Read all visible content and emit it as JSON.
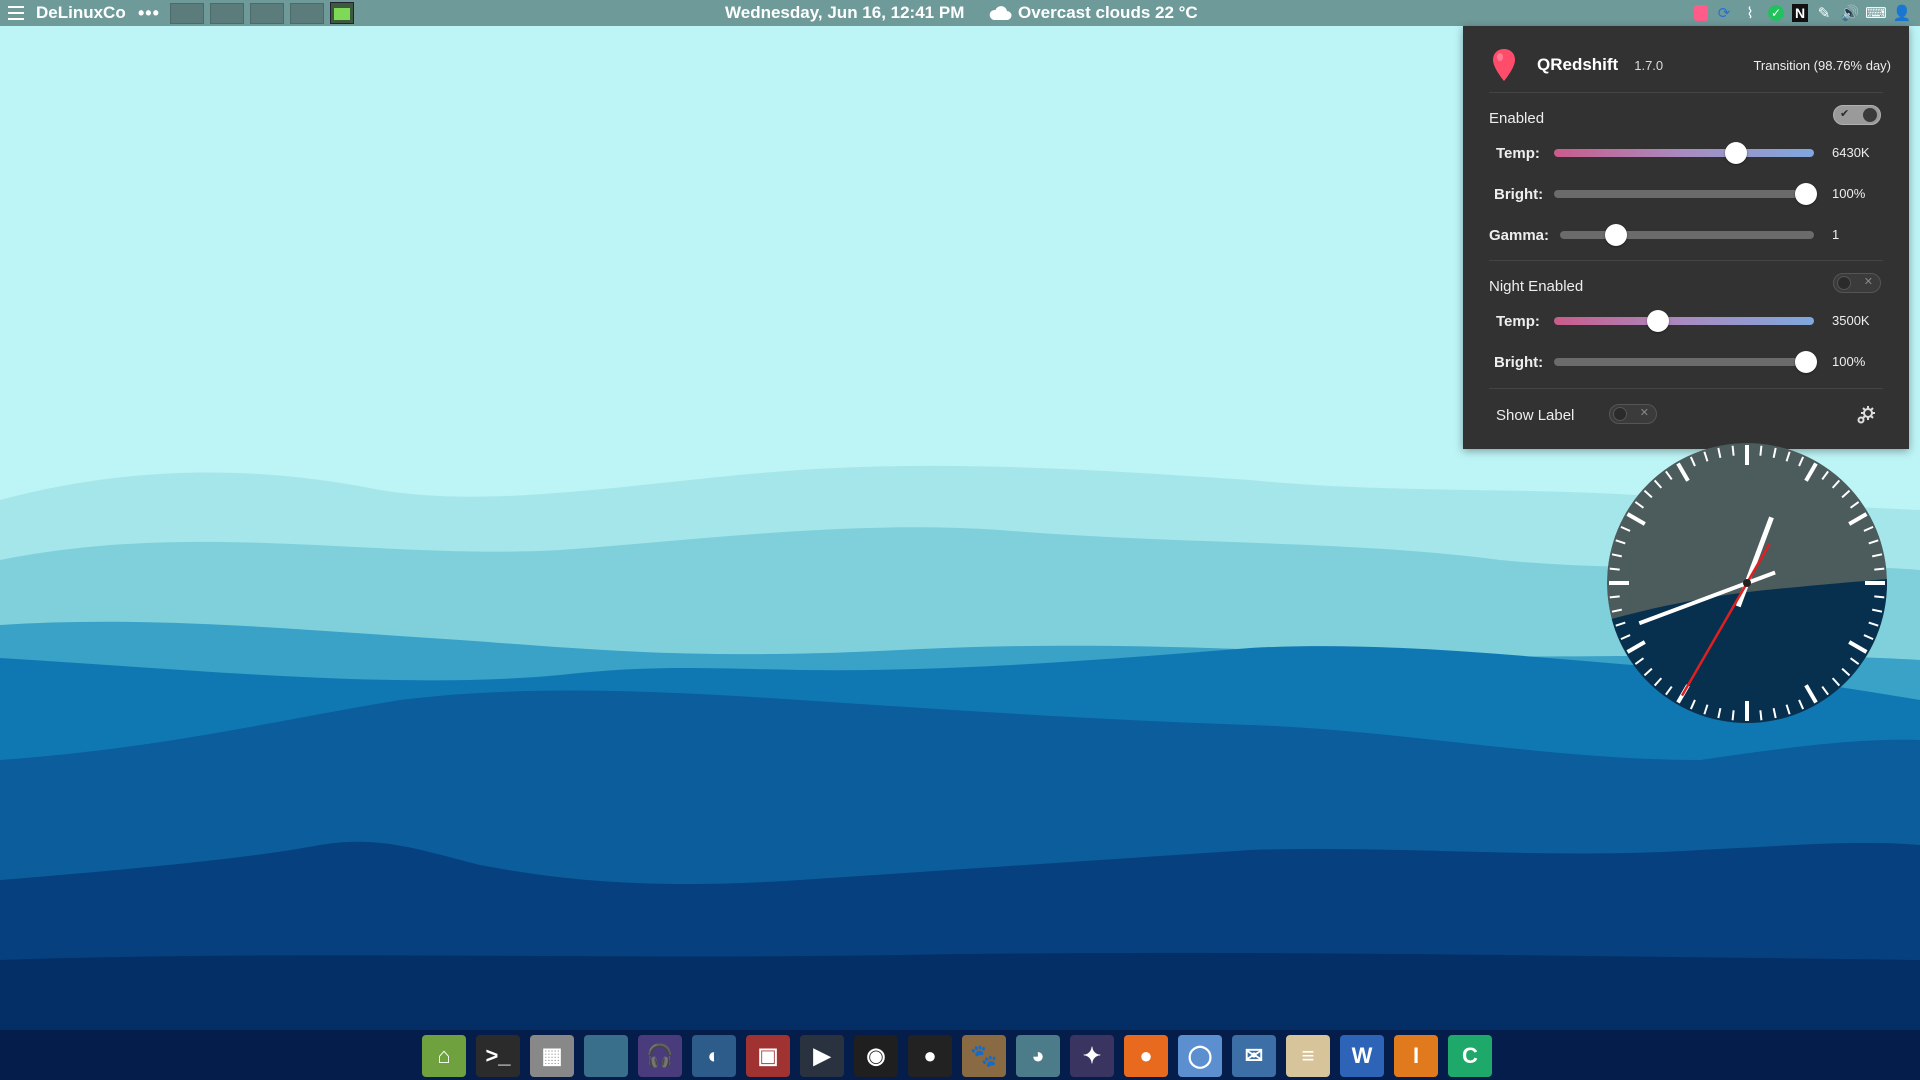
{
  "top_panel": {
    "brand": "DeLinuxCo",
    "more": "•••",
    "datetime": "Wednesday, Jun 16, 12:41 PM",
    "weather": "Overcast clouds 22 °C",
    "tray_icons": [
      "redshift-icon",
      "sync-icon",
      "paperclip-icon",
      "check-icon",
      "n-app-icon",
      "pen-icon",
      "volume-icon",
      "keyboard-icon",
      "user-icon"
    ]
  },
  "qredshift": {
    "app_name": "QRedshift",
    "version": "1.7.0",
    "transition": "Transition (98.76% day)",
    "day": {
      "enabled_label": "Enabled",
      "enabled": true,
      "temp_label": "Temp:",
      "temp_value": "6430K",
      "temp_level": 0.7,
      "bright_label": "Bright:",
      "bright_value": "100%",
      "bright_level": 0.97,
      "gamma_label": "Gamma:",
      "gamma_value": "1",
      "gamma_level": 0.22
    },
    "night": {
      "enabled_label": "Night Enabled",
      "enabled": false,
      "temp_label": "Temp:",
      "temp_value": "3500K",
      "temp_level": 0.4,
      "bright_label": "Bright:",
      "bright_value": "100%",
      "bright_level": 0.97
    },
    "show_label_label": "Show Label",
    "show_label": false
  },
  "clock": {
    "hour": 12,
    "minute": 41,
    "second": 35
  },
  "dock": {
    "items": [
      {
        "name": "home-folder-icon",
        "color": "#6fa13e",
        "glyph": "⌂"
      },
      {
        "name": "terminal-icon",
        "color": "#2b2b2b",
        "glyph": ">_"
      },
      {
        "name": "calculator-icon",
        "color": "#888888",
        "glyph": "▦"
      },
      {
        "name": "image-viewer-icon",
        "color": "#3a6f8c",
        "glyph": ""
      },
      {
        "name": "audio-player-icon",
        "color": "#4a3b7c",
        "glyph": "🎧"
      },
      {
        "name": "blender-icon",
        "color": "#2d5c8a",
        "glyph": "◐"
      },
      {
        "name": "video-editor-icon",
        "color": "#a03232",
        "glyph": "▣"
      },
      {
        "name": "media-player-icon",
        "color": "#2a3240",
        "glyph": "▶"
      },
      {
        "name": "camera-icon",
        "color": "#1f1f1f",
        "glyph": "◉"
      },
      {
        "name": "color-picker-icon",
        "color": "#222222",
        "glyph": "●"
      },
      {
        "name": "gimp-icon",
        "color": "#8a6a42",
        "glyph": "🐾"
      },
      {
        "name": "bluefish-icon",
        "color": "#4c7b8a",
        "glyph": "◕"
      },
      {
        "name": "inkscape-bird-icon",
        "color": "#3a3560",
        "glyph": "✦"
      },
      {
        "name": "firefox-icon",
        "color": "#e76a1f",
        "glyph": "●"
      },
      {
        "name": "chromium-icon",
        "color": "#5b8fcf",
        "glyph": "◯"
      },
      {
        "name": "mail-icon",
        "color": "#3b6fa6",
        "glyph": "✉"
      },
      {
        "name": "notes-icon",
        "color": "#d8c49a",
        "glyph": "≡"
      },
      {
        "name": "word-processor-icon",
        "color": "#2d64b8",
        "glyph": "W"
      },
      {
        "name": "impress-icon",
        "color": "#e07a1c",
        "glyph": "I"
      },
      {
        "name": "calc-icon",
        "color": "#1ea86a",
        "glyph": "C"
      }
    ]
  }
}
